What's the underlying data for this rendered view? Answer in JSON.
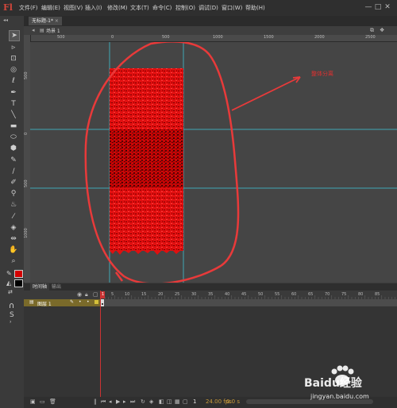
{
  "app": {
    "logo": "Fl"
  },
  "menu": [
    "文件(F)",
    "编辑(E)",
    "视图(V)",
    "插入(I)",
    "修改(M)",
    "文本(T)",
    "命令(C)",
    "控制(O)",
    "调试(D)",
    "窗口(W)",
    "帮助(H)"
  ],
  "window_controls": [
    "—",
    "□",
    "✕"
  ],
  "document": {
    "tab_title": "无标题-1*",
    "scene": "场景 1"
  },
  "hruler_labels": [
    "500",
    "0",
    "500",
    "1000",
    "1500",
    "2000",
    "2500"
  ],
  "vruler_labels": [
    "500",
    "0",
    "500",
    "1000"
  ],
  "annotation": {
    "text": "整体分离",
    "color": "#e03030"
  },
  "colors": {
    "accent": "#cc0000",
    "guide": "#3fa8b5",
    "annotation": "#e83a3a"
  },
  "timeline": {
    "tab_timeline": "时间轴",
    "tab_output": "输出",
    "frame_numbers": [
      "1",
      "5",
      "10",
      "15",
      "20",
      "25",
      "30",
      "35",
      "40",
      "45",
      "50",
      "55",
      "60",
      "65",
      "70",
      "75",
      "80",
      "85"
    ],
    "layer_name": "图层 1",
    "current_frame": "1",
    "fps": "24.00 fps",
    "elapsed": "0.0 s"
  },
  "toolbar_icons": [
    "selection-icon",
    "subselection-icon",
    "free-transform-icon",
    "3d-rotation-icon",
    "lasso-icon",
    "pen-icon",
    "text-icon",
    "line-icon",
    "rectangle-icon",
    "oval-icon",
    "polystar-icon",
    "pencil-icon",
    "brush-icon",
    "paint-brush-icon",
    "bone-icon",
    "paint-bucket-icon",
    "eyedropper-icon",
    "eraser-icon",
    "width-icon",
    "hand-icon",
    "zoom-icon",
    "stroke-color-icon",
    "fill-color-icon",
    "swap-colors-icon",
    "snap-icon",
    "smooth-icon",
    "straighten-icon"
  ],
  "watermark": {
    "brand": "Baidu经验",
    "url": "jingyan.baidu.com"
  }
}
